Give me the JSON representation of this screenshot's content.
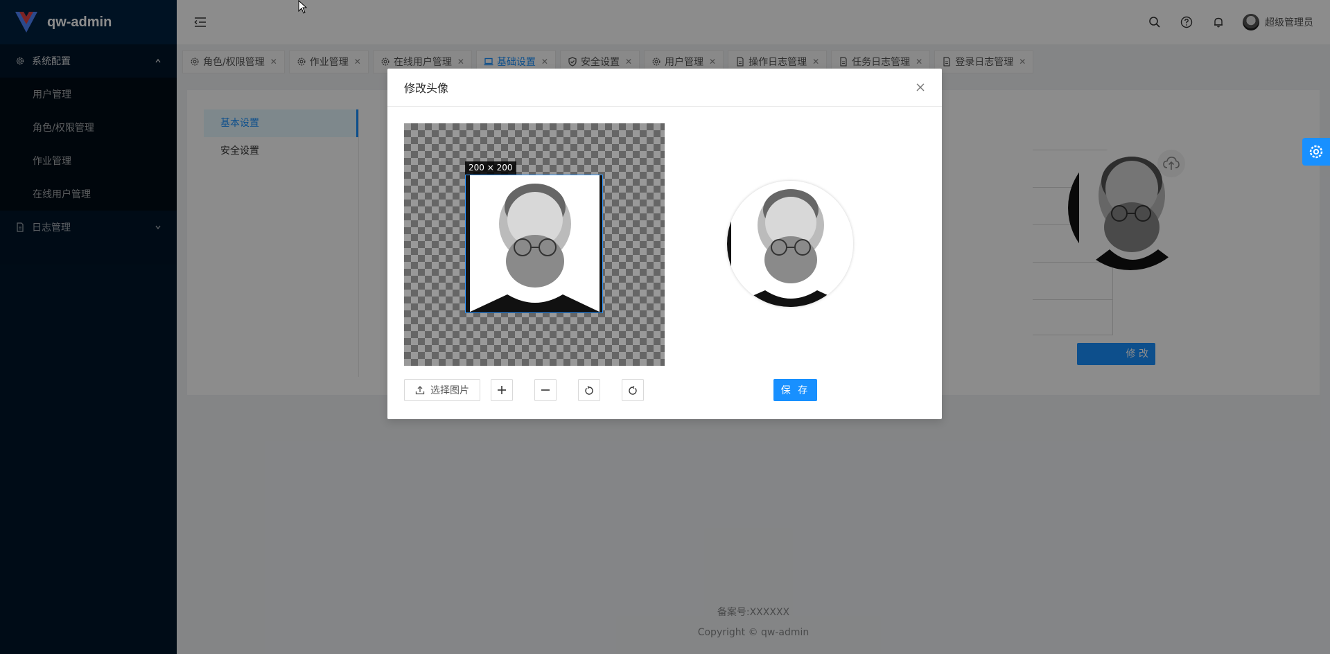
{
  "app": {
    "title": "qw-admin"
  },
  "sidebar": {
    "groups": [
      {
        "label": "系统配置",
        "icon": "gear-icon",
        "expanded": true,
        "items": [
          {
            "label": "用户管理"
          },
          {
            "label": "角色/权限管理"
          },
          {
            "label": "作业管理"
          },
          {
            "label": "在线用户管理"
          }
        ]
      },
      {
        "label": "日志管理",
        "icon": "file-icon",
        "expanded": false
      }
    ]
  },
  "header": {
    "username": "超级管理员"
  },
  "tabs": [
    {
      "label": "角色/权限管理",
      "icon": "gear-icon"
    },
    {
      "label": "作业管理",
      "icon": "gear-icon"
    },
    {
      "label": "在线用户管理",
      "icon": "gear-icon"
    },
    {
      "label": "基础设置",
      "icon": "laptop-icon",
      "active": true
    },
    {
      "label": "安全设置",
      "icon": "shield-icon"
    },
    {
      "label": "用户管理",
      "icon": "gear-icon"
    },
    {
      "label": "操作日志管理",
      "icon": "file-icon"
    },
    {
      "label": "任务日志管理",
      "icon": "file-icon"
    },
    {
      "label": "登录日志管理",
      "icon": "file-icon"
    }
  ],
  "settings_nav": [
    {
      "label": "基本设置",
      "active": true
    },
    {
      "label": "安全设置"
    }
  ],
  "background": {
    "modify_button": "修 改"
  },
  "modal": {
    "title": "修改头像",
    "crop_info": "200 × 200",
    "upload_label": "选择图片",
    "save_label": "保 存"
  },
  "footer": {
    "icp": "备案号:XXXXXX",
    "copyright": "Copyright © qw-admin"
  },
  "colors": {
    "primary": "#1890ff",
    "sidebar_bg": "#001529"
  }
}
